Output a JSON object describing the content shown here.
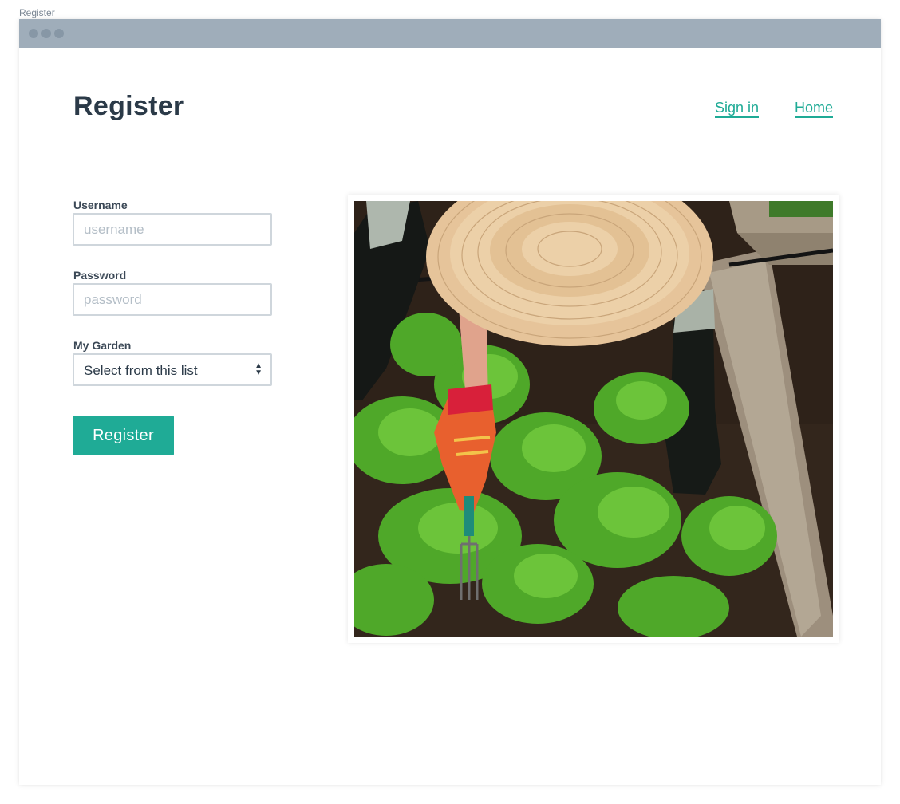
{
  "tab_caption": "Register",
  "header": {
    "title": "Register",
    "nav": {
      "sign_in": "Sign in",
      "home": "Home"
    }
  },
  "form": {
    "username": {
      "label": "Username",
      "placeholder": "username",
      "value": ""
    },
    "password": {
      "label": "Password",
      "placeholder": "password",
      "value": ""
    },
    "garden": {
      "label": "My Garden",
      "selected": "Select from this list"
    },
    "submit_label": "Register"
  },
  "image": {
    "icon": "garden-photo"
  },
  "colors": {
    "accent": "#1fab96",
    "title_text": "#2b3a48",
    "titlebar": "#9fadba"
  }
}
